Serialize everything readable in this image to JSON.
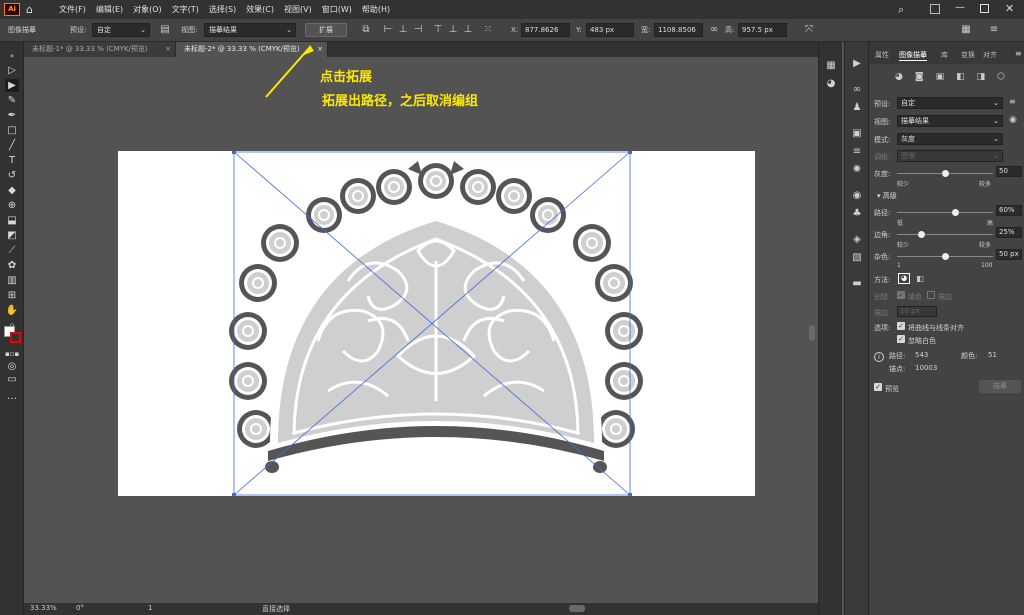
{
  "menubar": {
    "items": [
      "文件(F)",
      "编辑(E)",
      "对象(O)",
      "文字(T)",
      "选择(S)",
      "效果(C)",
      "视图(V)",
      "窗口(W)",
      "帮助(H)"
    ]
  },
  "control": {
    "panel_name": "图像描摹",
    "preset_label": "预设:",
    "preset_value": "自定",
    "view_label": "视图:",
    "view_value": "描摹结果",
    "expand_button": "扩展",
    "x_label": "X:",
    "x_value": "877.8626",
    "y_label": "Y:",
    "y_value": "483 px",
    "w_label": "宽:",
    "w_value": "1108.8506",
    "h_label": "高:",
    "h_value": "957.5 px"
  },
  "tabs": [
    {
      "label": "未标题-1* @ 33.33 % (CMYK/预览)",
      "active": false
    },
    {
      "label": "未标题-2* @ 33.33 % (CMYK/预览)",
      "active": true
    }
  ],
  "annotation": {
    "line1": "点击拓展",
    "line2": "拓展出路径，之后取消编组"
  },
  "panel": {
    "tabs": [
      "属性",
      "图像描摹",
      "库",
      "变换",
      "对齐"
    ],
    "active_tab": "图像描摹",
    "preset_label": "预设:",
    "preset_value": "自定",
    "view_label": "视图:",
    "view_value": "描摹结果",
    "mode_label": "模式:",
    "mode_value": "灰度",
    "palette_label": "调板:",
    "palette_value": "受限",
    "gray_label": "灰度:",
    "gray_value": "50",
    "gray_min": "较少",
    "gray_max": "较多",
    "gray_level": 0.5,
    "advanced_label": "高级",
    "path_label": "路径:",
    "path_value": "60%",
    "path_min": "低",
    "path_max": "高",
    "path_level": 0.6,
    "corner_label": "边角:",
    "corner_value": "25%",
    "corner_min": "较少",
    "corner_max": "较多",
    "corner_level": 0.25,
    "noise_label": "杂色:",
    "noise_value": "50 px",
    "noise_min": "1",
    "noise_max": "100",
    "noise_level": 0.5,
    "method_label": "方法:",
    "create_label": "创建:",
    "fill_label": "填色",
    "stroke_label": "描边",
    "stroke_field_label": "描边:",
    "stroke_value": "10 px",
    "options_label": "选项:",
    "option1": "将曲线与线条对齐",
    "option2": "忽略白色",
    "paths_label": "路径:",
    "paths_value": "543",
    "colors_label": "颜色:",
    "colors_value": "51",
    "anchors_label": "锚点:",
    "anchors_value": "10003",
    "preview_label": "预览",
    "trace_button": "描摹"
  },
  "status": {
    "zoom": "33.33%",
    "rotate": "0°",
    "page": "1",
    "tool": "直接选择"
  },
  "colors": {
    "annotation": "#ffe800",
    "selection": "#3b6fe0",
    "ornament_dark": "#555555",
    "ornament_light": "#cfcfcf"
  }
}
